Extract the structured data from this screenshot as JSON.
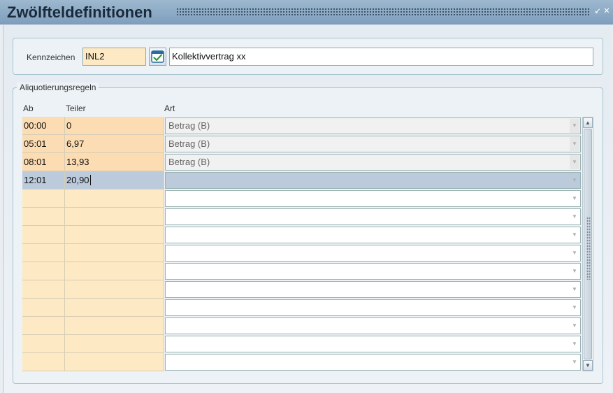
{
  "window": {
    "title": "Zwölfteldefinitionen",
    "icons": [
      "minimize-icon",
      "close-icon"
    ]
  },
  "header": {
    "kennzeichen_label": "Kennzeichen",
    "code_value": "INL2",
    "description_value": "Kollektivvertrag xx",
    "lookup_icon": "calendar-check-icon"
  },
  "rules": {
    "legend": "Aliquotierungsregeln",
    "columns": {
      "ab": "Ab",
      "teiler": "Teiler",
      "art": "Art"
    },
    "rows": [
      {
        "ab": "00:00",
        "teiler": "0",
        "art": "Betrag (B)"
      },
      {
        "ab": "05:01",
        "teiler": "6,97",
        "art": "Betrag (B)"
      },
      {
        "ab": "08:01",
        "teiler": "13,93",
        "art": "Betrag (B)"
      },
      {
        "ab": "12:01",
        "teiler": "20,90",
        "art": ""
      },
      {
        "ab": "",
        "teiler": "",
        "art": ""
      },
      {
        "ab": "",
        "teiler": "",
        "art": ""
      },
      {
        "ab": "",
        "teiler": "",
        "art": ""
      },
      {
        "ab": "",
        "teiler": "",
        "art": ""
      },
      {
        "ab": "",
        "teiler": "",
        "art": ""
      },
      {
        "ab": "",
        "teiler": "",
        "art": ""
      },
      {
        "ab": "",
        "teiler": "",
        "art": ""
      },
      {
        "ab": "",
        "teiler": "",
        "art": ""
      },
      {
        "ab": "",
        "teiler": "",
        "art": ""
      },
      {
        "ab": "",
        "teiler": "",
        "art": ""
      }
    ]
  },
  "colors": {
    "cell_bg": "#fde9c3",
    "cell_filled_bg": "#fbdcb3",
    "selected_row_bg": "#bccbdc",
    "titlebar": "#8fabc6"
  }
}
